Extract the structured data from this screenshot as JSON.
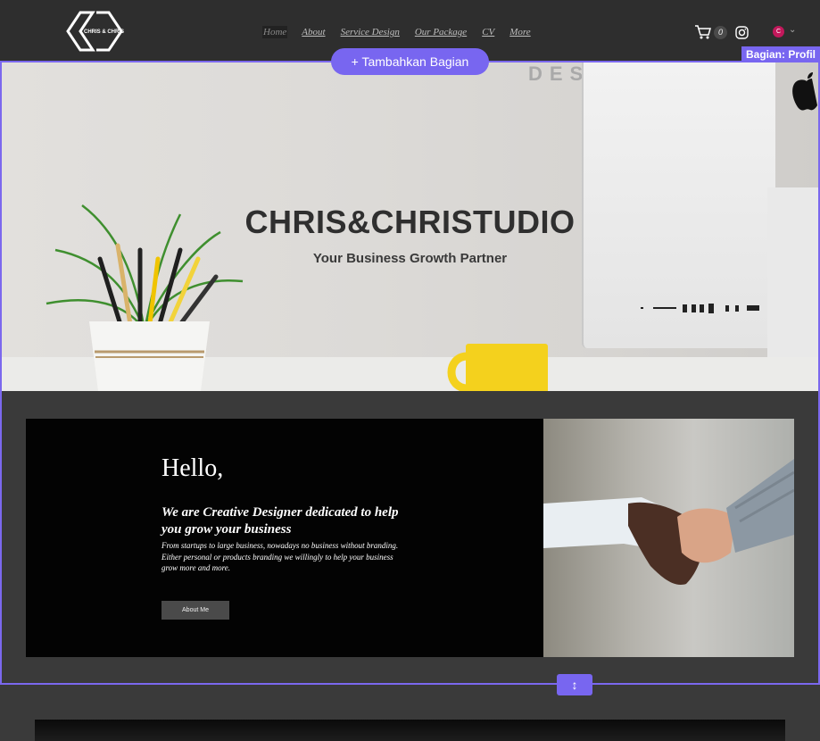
{
  "header": {
    "logo_text": "CHRIS & CHRIS",
    "nav": [
      "Home",
      "About",
      "Service Design",
      "Our Package",
      "CV",
      "More"
    ],
    "cart_count": "0",
    "lang_badge": "C"
  },
  "editor": {
    "add_section_label": "+ Tambahkan Bagian",
    "section_label": "Bagian: Profil",
    "resize_icon": "↕",
    "accent": "#7866f0"
  },
  "hero": {
    "background_text": "DES",
    "title": "CHRIS&CHRISTUDIO",
    "subtitle": "Your Business Growth Partner"
  },
  "intro": {
    "title": "Hello,",
    "lead": "We are Creative Designer dedicated to help you grow your business",
    "body": "From startups to large business, nowadays no business without branding. Either personal or products branding we willingly to help your business grow more and more.",
    "button_label": "About Me"
  }
}
